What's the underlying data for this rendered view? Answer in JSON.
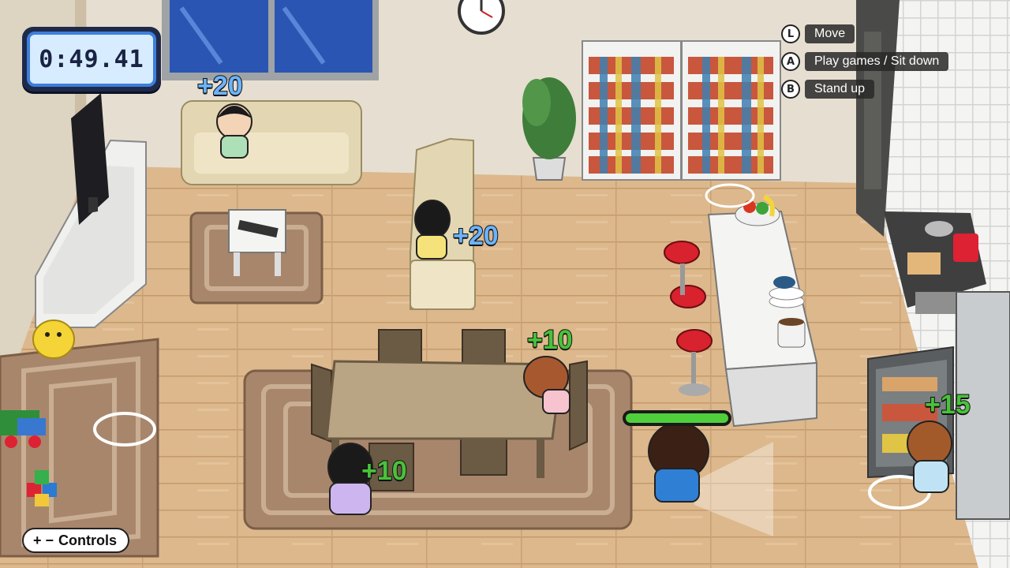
{
  "hud": {
    "timer": "0:49.41",
    "hints": [
      {
        "button": "L",
        "label": "Move"
      },
      {
        "button": "A",
        "label": "Play games / Sit down"
      },
      {
        "button": "B",
        "label": "Stand up"
      }
    ],
    "controls": {
      "symbols": "+ −",
      "label": "Controls"
    }
  },
  "scores": [
    {
      "text": "+20",
      "color": "#6ab4ff",
      "where": "sofa-child"
    },
    {
      "text": "+20",
      "color": "#6ab4ff",
      "where": "armchair-child"
    },
    {
      "text": "+10",
      "color": "#48c23a",
      "where": "table-sleeping-child"
    },
    {
      "text": "+10",
      "color": "#48c23a",
      "where": "table-child"
    },
    {
      "text": "+15",
      "color": "#48c23a",
      "where": "fridge-child"
    }
  ],
  "player_meter": {
    "fill": 1.0,
    "color": "#4fcf3c"
  },
  "colors": {
    "floor": "#d9b58a",
    "wall": "#e8e1d3",
    "timer_frame": "#1f2a4a",
    "timer_border": "#3d7fdc"
  }
}
